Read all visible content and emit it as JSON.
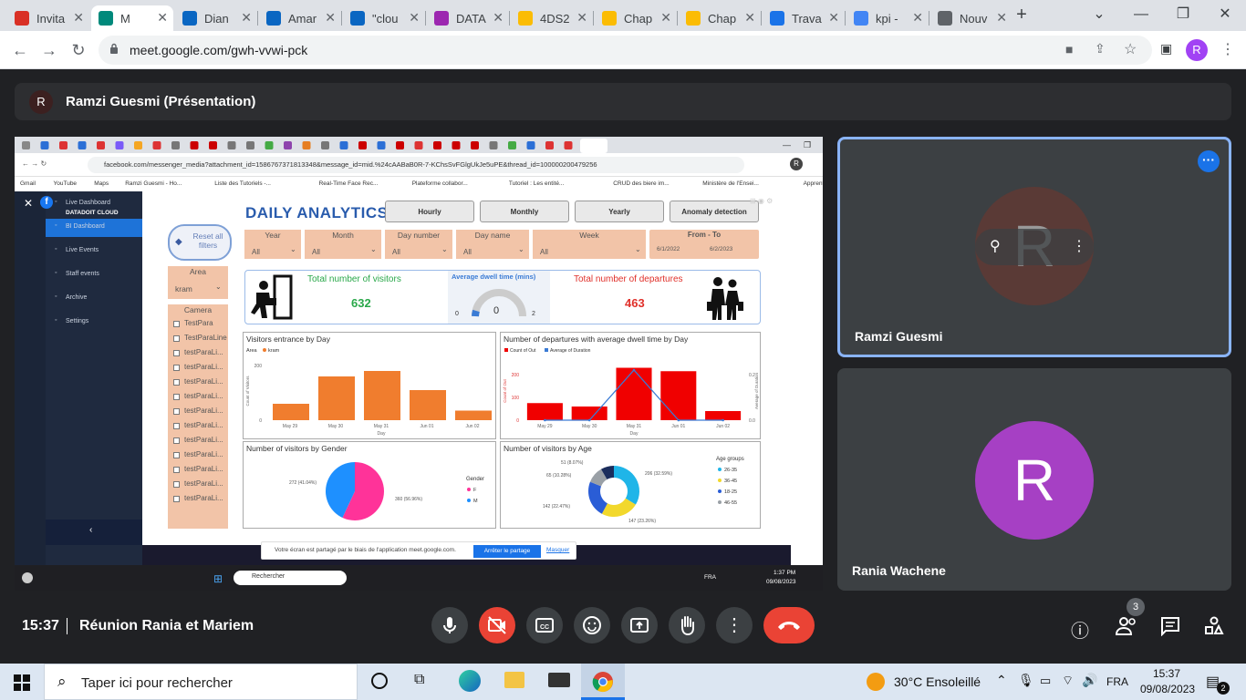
{
  "browser": {
    "tabs": [
      {
        "title": "Invita",
        "color": "#d93025",
        "icon": "gmail-icon"
      },
      {
        "title": "M",
        "color": "#00897b",
        "icon": "meet-icon",
        "active": true
      },
      {
        "title": "Dian",
        "color": "#0a66c2",
        "icon": "linkedin-icon"
      },
      {
        "title": "Amar",
        "color": "#0a66c2",
        "icon": "linkedin-icon"
      },
      {
        "title": "\"clou",
        "color": "#0a66c2",
        "icon": "linkedin-icon"
      },
      {
        "title": "DATA",
        "color": "#9c27b0",
        "icon": "hexagon-icon"
      },
      {
        "title": "4DS2",
        "color": "#fbbc04",
        "icon": "drive-icon"
      },
      {
        "title": "Chap",
        "color": "#fbbc04",
        "icon": "drive-icon"
      },
      {
        "title": "Chap",
        "color": "#fbbc04",
        "icon": "drive-icon"
      },
      {
        "title": "Trava",
        "color": "#1a73e8",
        "icon": "classroom-icon"
      },
      {
        "title": "kpi -",
        "color": "#4285f4",
        "icon": "forms-icon"
      },
      {
        "title": "Nouv",
        "color": "#5f6368",
        "icon": "chrome-icon"
      }
    ],
    "new_tab": "+",
    "url": "meet.google.com/gwh-vvwi-pck",
    "profile_initial": "R"
  },
  "meet": {
    "presenter_initial": "R",
    "presenter_label": "Ramzi Guesmi (Présentation)",
    "participants": [
      {
        "name": "Ramzi Guesmi",
        "initial": "R",
        "color": "#5a3a36"
      },
      {
        "name": "Rania Wachene",
        "initial": "R",
        "color": "#a640c4"
      }
    ],
    "time": "15:37",
    "meeting_title": "Réunion Rania et Mariem",
    "participant_count": "3"
  },
  "shared": {
    "inner_url": "facebook.com/messenger_media?attachment_id=1586767371813348&message_id=mid.%24cAABaB0R-7-KChsSvFGlgUkJe5uPE&thread_id=100000200479256",
    "bookmarks": [
      "Gmail",
      "YouTube",
      "Maps",
      "Ramzi Guesmi - Ho...",
      "Liste des Tutoriels -...",
      "Real-Time Face Rec...",
      "Plateforme collabor...",
      "Tutoriel : Les entité...",
      "CRUD des biere im...",
      "Ministère de l'Ensei...",
      "Apprentissage auto..."
    ],
    "sidebar": {
      "brand": "DATADOIT CLOUD",
      "items": [
        "Live Dashboard",
        "BI Dashboard",
        "Live Events",
        "Staff events",
        "Archive",
        "Settings"
      ]
    },
    "dashboard": {
      "title": "DAILY ANALYTICS",
      "tabs": [
        "Hourly",
        "Monthly",
        "Yearly",
        "Anomaly detection"
      ],
      "reset": "Reset all filters",
      "filters": [
        {
          "label": "Year",
          "value": "All"
        },
        {
          "label": "Month",
          "value": "All"
        },
        {
          "label": "Day number",
          "value": "All"
        },
        {
          "label": "Day name",
          "value": "All"
        },
        {
          "label": "Week",
          "value": "All"
        }
      ],
      "date_range": {
        "label": "From - To",
        "from": "6/1/2022",
        "to": "6/2/2023"
      },
      "area": {
        "label": "Area",
        "value": "kram"
      },
      "camera": {
        "label": "Camera",
        "items": [
          "TestPara",
          "TestParaLine",
          "testParaLi...",
          "testParaLi...",
          "testParaLi...",
          "testParaLi...",
          "testParaLi...",
          "testParaLi...",
          "testParaLi...",
          "testParaLi...",
          "testParaLi...",
          "testParaLi...",
          "testParaLi..."
        ]
      },
      "kpis": {
        "visitors_label": "Total number of visitors",
        "visitors": "632",
        "dwell_label": "Average dwell time (mins)",
        "dwell": "0",
        "dwell_min": "0",
        "dwell_max": "2",
        "departures_label": "Total number of departures",
        "departures": "463"
      },
      "chart1": {
        "title": "Visitors entrance by Day",
        "legend_key": "Area",
        "legend_item": "kram",
        "xlabel": "Day",
        "ylabel": "Count of Visitors",
        "y_ticks": [
          "200",
          "0"
        ]
      },
      "chart2": {
        "title": "Number of departures with average dwell time by Day",
        "legend1": "Count of Out",
        "legend2": "Average of Duration",
        "xlabel": "Day",
        "ylabel": "Count of Out",
        "y2label": "Average of Duration",
        "y_ticks": [
          "200",
          "100",
          "0"
        ],
        "y2_ticks": [
          "0.2",
          "0.0"
        ]
      },
      "chart3": {
        "title": "Number of visitors by Gender",
        "legend_title": "Gender",
        "labels": [
          "272 (41.04%)",
          "360 (56.96%)"
        ],
        "legend": [
          "F",
          "M"
        ]
      },
      "chart4": {
        "title": "Number of visitors by Age",
        "legend_title": "Age groups",
        "labels": [
          "51 (8.07%)",
          "65 (10.28%)",
          "142 (22.47%)",
          "147 (23.26%)",
          "206 (32.59%)"
        ],
        "legend": [
          "26-35",
          "36-45",
          "18-25",
          "46-55"
        ]
      }
    },
    "share_notice": "Votre écran est partagé par le biais de l'application meet.google.com.",
    "stop_share": "Arrêter le partage",
    "hide": "Masquer",
    "inner_taskbar": {
      "search": "Rechercher",
      "lang": "FRA",
      "time": "1:37 PM",
      "date": "09/08/2023"
    }
  },
  "chart_data": [
    {
      "type": "bar",
      "title": "Visitors entrance by Day",
      "xlabel": "Day",
      "ylabel": "Count of Visitors",
      "categories": [
        "May 29",
        "May 30",
        "May 31",
        "Jun 01",
        "Jun 02"
      ],
      "values": [
        60,
        160,
        180,
        110,
        35
      ],
      "ylim": [
        0,
        220
      ],
      "color": "#f07d2e"
    },
    {
      "type": "bar",
      "title": "Number of departures with average dwell time by Day",
      "xlabel": "Day",
      "ylabel": "Count of Out",
      "categories": [
        "May 29",
        "May 30",
        "May 31",
        "Jun 01",
        "Jun 02"
      ],
      "series": [
        {
          "name": "Count of Out",
          "values": [
            75,
            60,
            230,
            215,
            40
          ],
          "color": "#f00000"
        },
        {
          "name": "Average of Duration",
          "values": [
            0.0,
            0.0,
            0.22,
            0.0,
            0.0
          ],
          "color": "#3a7bd5"
        }
      ],
      "ylim": [
        0,
        280
      ],
      "y2lim": [
        0,
        0.28
      ]
    },
    {
      "type": "pie",
      "title": "Number of visitors by Gender",
      "categories": [
        "F",
        "M"
      ],
      "values": [
        360,
        272
      ],
      "colors": [
        "#ff3399",
        "#1e90ff"
      ]
    },
    {
      "type": "pie",
      "title": "Number of visitors by Age",
      "categories": [
        "26-35",
        "36-45",
        "18-25",
        "46-55",
        "other"
      ],
      "values": [
        206,
        147,
        142,
        65,
        51
      ],
      "colors": [
        "#1fb5e8",
        "#f2d82c",
        "#2a5dd6",
        "#9aa0a6",
        "#1b2d5c"
      ]
    }
  ],
  "taskbar": {
    "search_placeholder": "Taper ici pour rechercher",
    "weather": "30°C Ensoleillé",
    "lang": "FRA",
    "time": "15:37",
    "date": "09/08/2023",
    "notifications": "2"
  }
}
